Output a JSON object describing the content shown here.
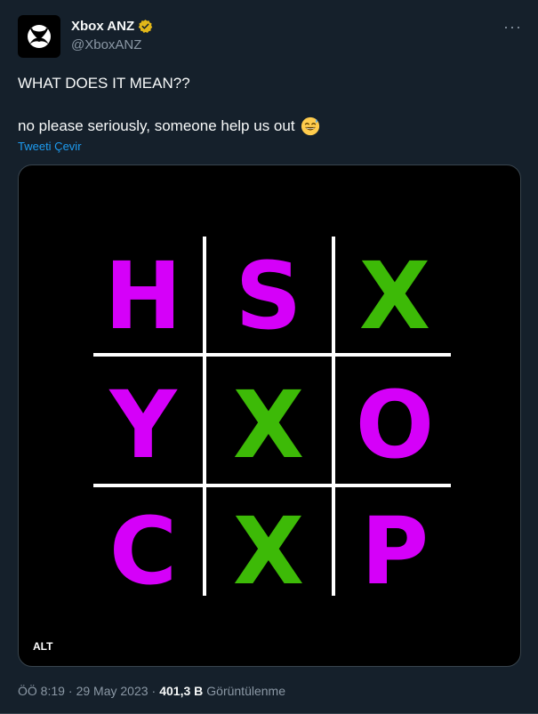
{
  "account": {
    "display_name": "Xbox ANZ",
    "handle": "@XboxANZ",
    "verified_color": "#e2b719"
  },
  "tweet": {
    "line1": "WHAT DOES IT MEAN??",
    "line2": "no please seriously, someone help us out",
    "emoji": "grinning-face-with-sweat",
    "translate_label": "Tweeti Çevir",
    "more_label": "···"
  },
  "media": {
    "alt_label": "ALT",
    "background": "#000000",
    "grid_color": "#ffffff",
    "cells": [
      {
        "letter": "H",
        "color": "#d500f9"
      },
      {
        "letter": "S",
        "color": "#d500f9"
      },
      {
        "letter": "X",
        "color": "#3dba07"
      },
      {
        "letter": "Y",
        "color": "#d500f9"
      },
      {
        "letter": "X",
        "color": "#3dba07"
      },
      {
        "letter": "O",
        "color": "#d500f9"
      },
      {
        "letter": "C",
        "color": "#d500f9"
      },
      {
        "letter": "X",
        "color": "#3dba07"
      },
      {
        "letter": "P",
        "color": "#d500f9"
      }
    ]
  },
  "meta": {
    "time": "ÖÖ 8:19",
    "separator": "·",
    "date": "29 May 2023",
    "views_count": "401,3 B",
    "views_label": "Görüntülenme"
  }
}
